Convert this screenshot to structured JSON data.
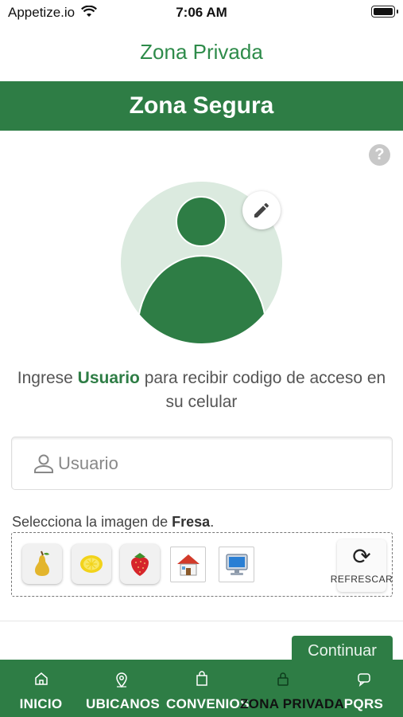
{
  "status_bar": {
    "carrier": "Appetize.io",
    "time": "7:06 AM"
  },
  "header": {
    "title": "Zona Privada",
    "banner": "Zona Segura"
  },
  "help_icon": "?",
  "instruction": {
    "prefix": "Ingrese ",
    "highlight": "Usuario",
    "suffix": " para recibir codigo de acceso en su celular"
  },
  "user_field": {
    "placeholder": "Usuario",
    "value": ""
  },
  "captcha": {
    "label_prefix": "Selecciona la imagen de ",
    "target": "Fresa",
    "label_suffix": ".",
    "images": [
      "pear",
      "lemon",
      "strawberry",
      "house",
      "computer"
    ],
    "refresh_label": "REFRESCAR"
  },
  "continue_label": "Continuar",
  "tabs": [
    {
      "label": "INICIO",
      "icon": "home-icon"
    },
    {
      "label": "UBICANOS",
      "icon": "location-pin-icon"
    },
    {
      "label": "CONVENIOS",
      "icon": "shopping-bag-icon"
    },
    {
      "label": "ZONA PRIVADA",
      "icon": "lock-icon",
      "active": true
    },
    {
      "label": "PQRS",
      "icon": "chat-icon"
    }
  ],
  "colors": {
    "brand_green": "#2e7d45",
    "title_green": "#2e8b4a",
    "avatar_bg": "#dbeadf"
  }
}
